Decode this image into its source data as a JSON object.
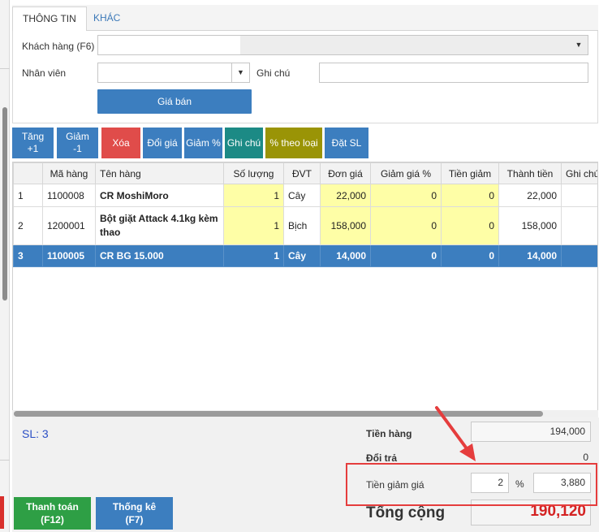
{
  "tabs": [
    {
      "label": "THÔNG TIN",
      "active": true
    },
    {
      "label": "KHÁC",
      "active": false
    }
  ],
  "form": {
    "customer_label": "Khách hàng (F6)",
    "customer_value": "",
    "staff_label": "Nhân viên",
    "staff_value": "",
    "note_label": "Ghi chú",
    "note_value": "",
    "price_button": "Giá bán"
  },
  "toolbar": {
    "increase": [
      "Tăng",
      "+1"
    ],
    "decrease": [
      "Giảm",
      "-1"
    ],
    "delete": "Xóa",
    "change_price": "Đổi giá",
    "discount_pct": "Giảm %",
    "note": "Ghi chú",
    "pct_by_type": "% theo loại",
    "set_qty": "Đặt SL"
  },
  "grid": {
    "columns": [
      "",
      "Mã hàng",
      "Tên hàng",
      "Số lượng",
      "ĐVT",
      "Đơn giá",
      "Giảm giá %",
      "Tiền giảm",
      "Thành tiền",
      "Ghi chú"
    ],
    "rows": [
      {
        "no": "1",
        "code": "1100008",
        "name": "CR MoshiMoro",
        "qty": "1",
        "unit": "Cây",
        "price": "22,000",
        "disc_pct": "0",
        "disc_amt": "0",
        "total": "22,000",
        "note": "",
        "selected": false
      },
      {
        "no": "2",
        "code": "1200001",
        "name": "Bột giặt Attack 4.1kg kèm thao",
        "qty": "1",
        "unit": "Bịch",
        "price": "158,000",
        "disc_pct": "0",
        "disc_amt": "0",
        "total": "158,000",
        "note": "",
        "selected": false
      },
      {
        "no": "3",
        "code": "1100005",
        "name": "CR BG 15.000",
        "qty": "1",
        "unit": "Cây",
        "price": "14,000",
        "disc_pct": "0",
        "disc_amt": "0",
        "total": "14,000",
        "note": "",
        "selected": true
      }
    ]
  },
  "summary": {
    "count_label": "SL: 3",
    "goods_label": "Tiền hàng",
    "goods_value": "194,000",
    "return_label": "Đổi trả",
    "return_value": "0",
    "discount_label": "Tiền giảm giá",
    "discount_pct": "2",
    "pct_sign": "%",
    "discount_value": "3,880",
    "total_label": "Tổng cộng",
    "total_value": "190,120"
  },
  "actions": {
    "pay": [
      "Thanh toán",
      "(F12)"
    ],
    "stats": [
      "Thống kê",
      "(F7)"
    ]
  },
  "colors": {
    "accent_blue": "#3c7ebf",
    "danger_red": "#e04c4a",
    "teal": "#1c8a85",
    "olive": "#9a9406",
    "pay_green": "#2e9f45",
    "total_red": "#d42222",
    "highlight_red": "#e53d3d",
    "editable_yellow": "#fefea6"
  }
}
